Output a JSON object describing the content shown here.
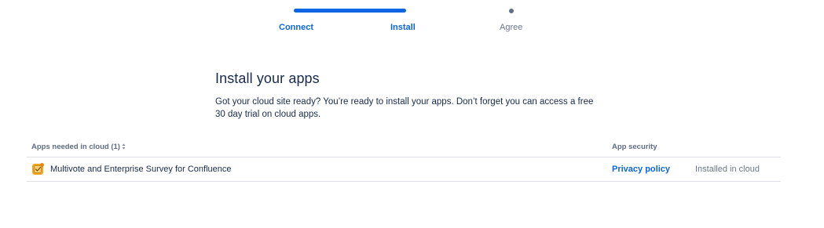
{
  "progress": {
    "steps": [
      {
        "label": "Connect",
        "state": "complete"
      },
      {
        "label": "Install",
        "state": "current"
      },
      {
        "label": "Agree",
        "state": "upcoming"
      }
    ],
    "colors": {
      "active": "#0c66e4",
      "inactive": "#626f86"
    }
  },
  "main": {
    "title": "Install your apps",
    "description": "Got your cloud site ready? You’re ready to install your apps. Don’t forget you can access a free 30 day trial on cloud apps."
  },
  "table": {
    "columns": {
      "apps": "Apps needed in cloud (1)",
      "security": "App security"
    },
    "sort_icon": "sort-icon",
    "rows": [
      {
        "icon": "survey-app-icon",
        "name": "Multivote and Enterprise Survey for Confluence",
        "security_link": "Privacy policy",
        "status": "Installed in cloud"
      }
    ]
  }
}
